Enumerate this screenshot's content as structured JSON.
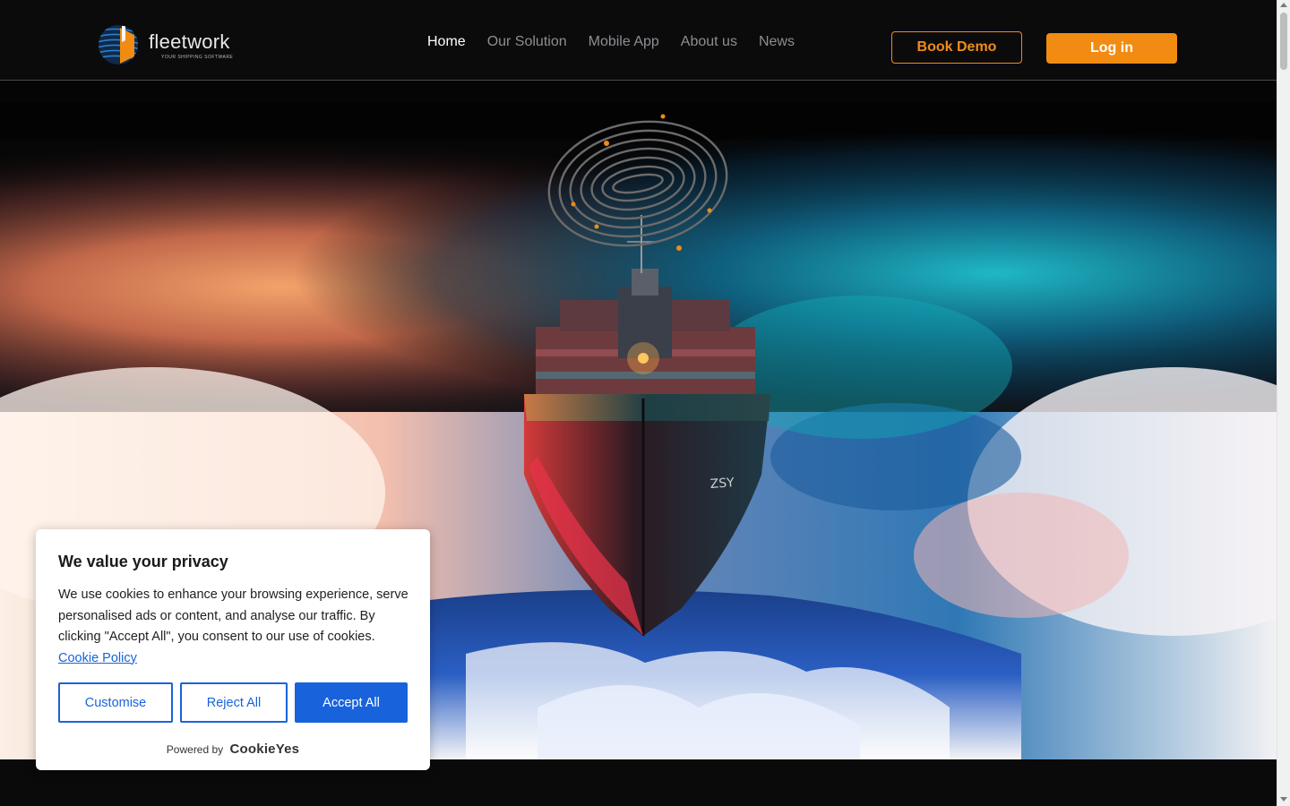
{
  "header": {
    "logo_text": "fleetwork",
    "logo_tagline": "YOUR SHIPPING SOFTWARE",
    "nav": [
      {
        "label": "Home",
        "active": true
      },
      {
        "label": "Our Solution",
        "active": false
      },
      {
        "label": "Mobile App",
        "active": false
      },
      {
        "label": "About us",
        "active": false
      },
      {
        "label": "News",
        "active": false
      }
    ],
    "book_demo_label": "Book Demo",
    "login_label": "Log in"
  },
  "hero": {
    "image": "container-ship-in-stormy-sea",
    "emblem": "fingerprint-globe-emblem"
  },
  "cookie_banner": {
    "title": "We value your privacy",
    "body": "We use cookies to enhance your browsing experience, serve personalised ads or content, and analyse our traffic. By clicking \"Accept All\", you consent to our use of cookies.",
    "link_label": "Cookie Policy",
    "customise_label": "Customise",
    "reject_label": "Reject All",
    "accept_label": "Accept All",
    "powered_by_label": "Powered by",
    "powered_by_brand": "CookieYes"
  },
  "colors": {
    "accent_orange": "#f28b12",
    "cookie_blue": "#1863dc",
    "header_bg": "#0b0b0c"
  }
}
